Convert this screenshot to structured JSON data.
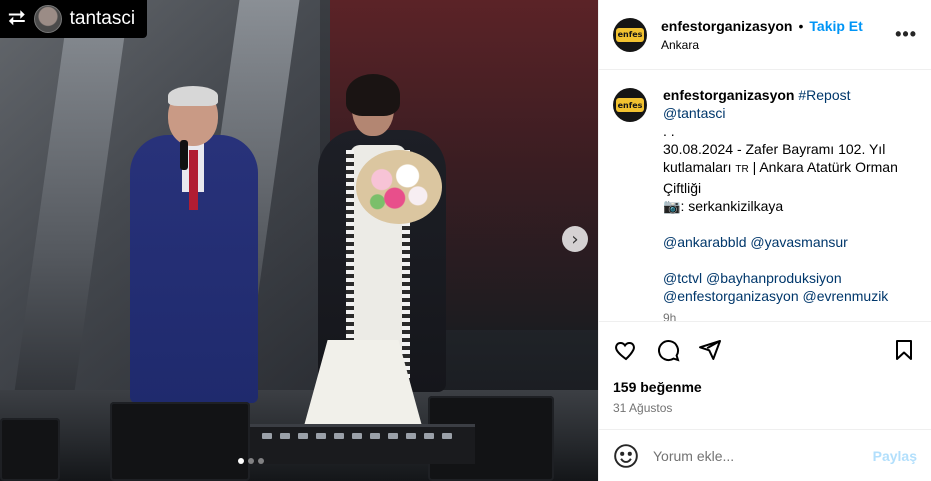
{
  "repost_overlay": {
    "icon": "repost-icon",
    "username": "tantasci"
  },
  "header": {
    "username": "enfestorganizasyon",
    "separator": "•",
    "follow_label": "Takip Et",
    "location": "Ankara",
    "more_icon": "more-icon"
  },
  "caption": {
    "username": "enfestorganizasyon",
    "hashtag": "#Repost",
    "mention_source": "@tantasci",
    "dots": ". .",
    "line1": "30.08.2024 - Zafer Bayramı 102. Yıl kutlamaları",
    "flag": "TR",
    "line1b": "| Ankara Atatürk Orman Çiftliği",
    "camera_icon": "camera-icon",
    "photo_credit": ": serkankizilkaya",
    "mentions1": "@ankarabbld @yavasmansur",
    "mentions2": "@tctvl @bayhanproduksiyon @enfestorganizasyon @evrenmuzik",
    "time": "9h"
  },
  "actions": {
    "like_icon": "heart-icon",
    "comment_icon": "comment-icon",
    "share_icon": "send-icon",
    "save_icon": "bookmark-icon"
  },
  "likes": "159 beğenme",
  "date": "31 Ağustos",
  "comment_box": {
    "placeholder": "Yorum ekle...",
    "post_label": "Paylaş",
    "emoji_icon": "emoji-icon"
  },
  "carousel": {
    "next_icon": "chevron-right-icon",
    "dots": 3,
    "active": 1
  }
}
